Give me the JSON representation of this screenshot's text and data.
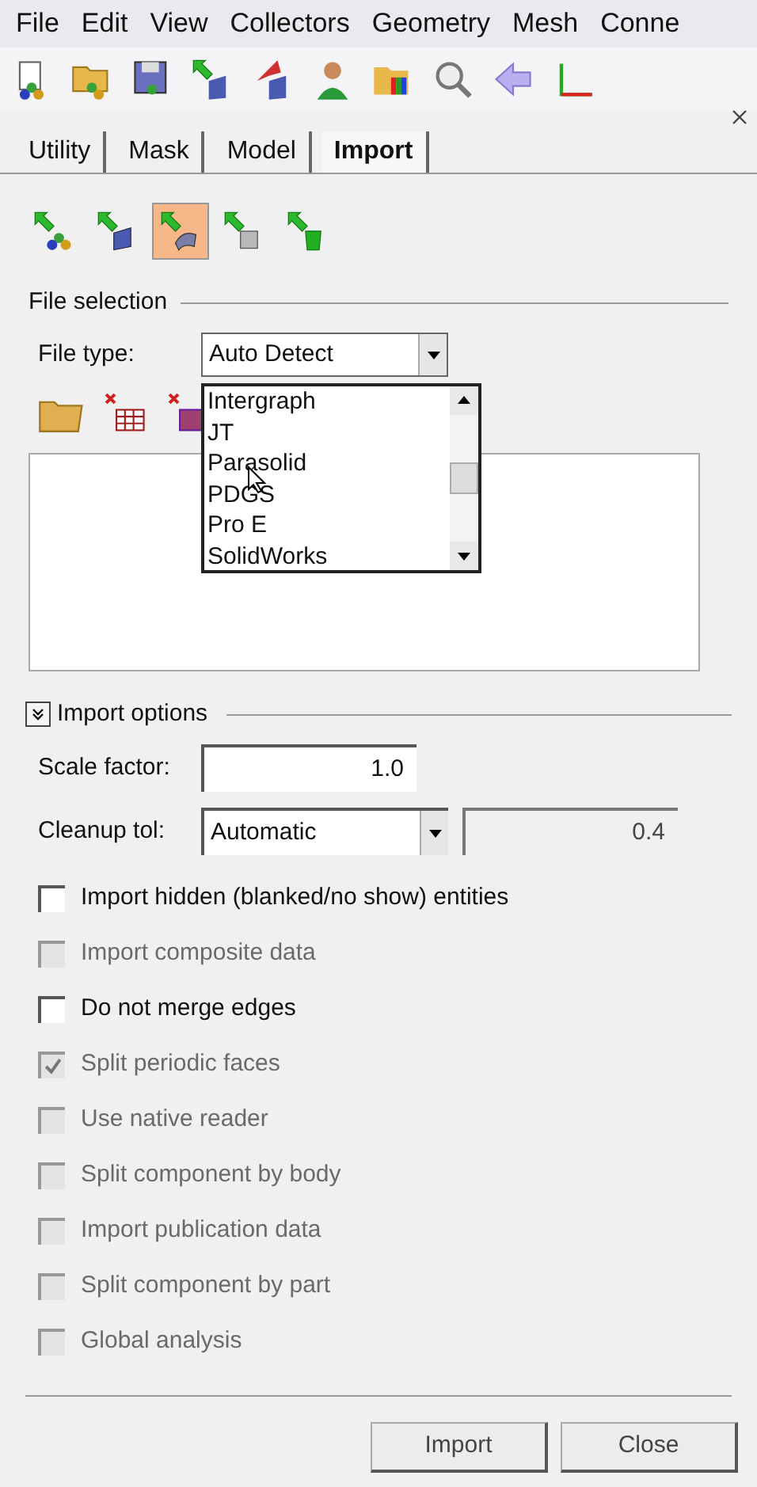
{
  "menu": [
    "File",
    "Edit",
    "View",
    "Collectors",
    "Geometry",
    "Mesh",
    "Conne"
  ],
  "tabs": [
    {
      "label": "Utility",
      "selected": false
    },
    {
      "label": "Mask",
      "selected": false
    },
    {
      "label": "Model",
      "selected": false
    },
    {
      "label": "Import",
      "selected": true
    }
  ],
  "import_types": [
    {
      "selected": false
    },
    {
      "selected": false
    },
    {
      "selected": true
    },
    {
      "selected": false
    },
    {
      "selected": false
    }
  ],
  "file_selection": {
    "title": "File selection",
    "file_type_label": "File type:",
    "file_type_value": "Auto Detect",
    "dropdown_options": [
      {
        "label": "Intergraph"
      },
      {
        "label": "JT"
      },
      {
        "label": "Parasolid"
      },
      {
        "label": "PDGS"
      },
      {
        "label": "Pro E"
      },
      {
        "label": "SolidWorks"
      }
    ]
  },
  "import_options": {
    "title": "Import options",
    "expanded": true,
    "scale_label": "Scale factor:",
    "scale_value": "1.0",
    "cleanup_label": "Cleanup tol:",
    "cleanup_mode": "Automatic",
    "cleanup_value": "0.4",
    "checkboxes": [
      {
        "label": "Import hidden (blanked/no show) entities",
        "checked": false,
        "disabled": false
      },
      {
        "label": "Import composite data",
        "checked": false,
        "disabled": true
      },
      {
        "label": "Do not merge edges",
        "checked": false,
        "disabled": false
      },
      {
        "label": "Split periodic faces",
        "checked": true,
        "disabled": true
      },
      {
        "label": "Use native reader",
        "checked": false,
        "disabled": true
      },
      {
        "label": "Split component by body",
        "checked": false,
        "disabled": true
      },
      {
        "label": "Import publication data",
        "checked": false,
        "disabled": true
      },
      {
        "label": "Split component by part",
        "checked": false,
        "disabled": true
      },
      {
        "label": "Global analysis",
        "checked": false,
        "disabled": true
      }
    ]
  },
  "buttons": [
    {
      "label": "Import"
    },
    {
      "label": "Close"
    }
  ]
}
